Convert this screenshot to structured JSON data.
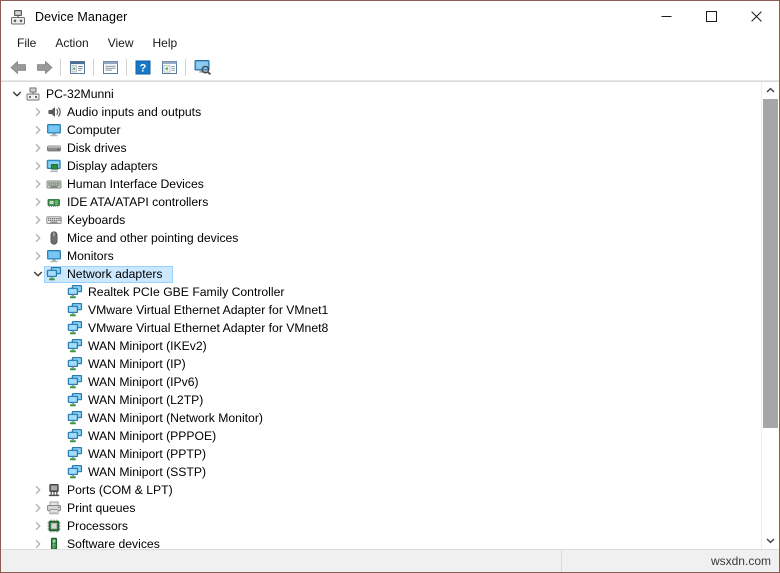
{
  "window": {
    "title": "Device Manager",
    "icon": "device-manager-icon",
    "border_color": "#8d5d53",
    "controls": [
      {
        "name": "minimize",
        "glyph": "minimize-icon"
      },
      {
        "name": "maximize",
        "glyph": "maximize-icon"
      },
      {
        "name": "close",
        "glyph": "close-icon"
      }
    ]
  },
  "menubar": {
    "items": [
      {
        "label": "File"
      },
      {
        "label": "Action"
      },
      {
        "label": "View"
      },
      {
        "label": "Help"
      }
    ]
  },
  "toolbar": {
    "buttons": [
      {
        "name": "back-button",
        "icon": "back-arrow-icon"
      },
      {
        "name": "forward-button",
        "icon": "forward-arrow-icon"
      },
      {
        "name": "separator-1",
        "icon": "separator"
      },
      {
        "name": "show-hide-console-tree-button",
        "icon": "console-tree-icon"
      },
      {
        "name": "separator-2",
        "icon": "separator"
      },
      {
        "name": "properties-button",
        "icon": "properties-icon"
      },
      {
        "name": "separator-3",
        "icon": "separator"
      },
      {
        "name": "help-button",
        "icon": "help-question-icon"
      },
      {
        "name": "update-driver-button",
        "icon": "update-driver-icon"
      },
      {
        "name": "separator-4",
        "icon": "separator"
      },
      {
        "name": "scan-for-hardware-changes-button",
        "icon": "scan-hardware-icon"
      }
    ]
  },
  "tree": {
    "root": {
      "label": "PC-32Munni",
      "icon": "computer-root-icon",
      "expanded": true,
      "indent": 0
    },
    "nodes": [
      {
        "label": "Audio inputs and outputs",
        "icon": "speaker-icon",
        "state": "collapsed",
        "indent": 1
      },
      {
        "label": "Computer",
        "icon": "monitor-icon",
        "state": "collapsed",
        "indent": 1
      },
      {
        "label": "Disk drives",
        "icon": "disk-drive-icon",
        "state": "collapsed",
        "indent": 1
      },
      {
        "label": "Display adapters",
        "icon": "display-adapter-icon",
        "state": "collapsed",
        "indent": 1
      },
      {
        "label": "Human Interface Devices",
        "icon": "hid-icon",
        "state": "collapsed",
        "indent": 1
      },
      {
        "label": "IDE ATA/ATAPI controllers",
        "icon": "ide-controller-icon",
        "state": "collapsed",
        "indent": 1
      },
      {
        "label": "Keyboards",
        "icon": "keyboard-icon",
        "state": "collapsed",
        "indent": 1
      },
      {
        "label": "Mice and other pointing devices",
        "icon": "mouse-icon",
        "state": "collapsed",
        "indent": 1
      },
      {
        "label": "Monitors",
        "icon": "monitor-icon",
        "state": "collapsed",
        "indent": 1
      },
      {
        "label": "Network adapters",
        "icon": "network-adapter-icon",
        "state": "expanded",
        "indent": 1,
        "selected": true
      },
      {
        "label": "Realtek PCIe GBE Family Controller",
        "icon": "network-adapter-icon",
        "state": "leaf",
        "indent": 2
      },
      {
        "label": "VMware Virtual Ethernet Adapter for VMnet1",
        "icon": "network-adapter-icon",
        "state": "leaf",
        "indent": 2
      },
      {
        "label": "VMware Virtual Ethernet Adapter for VMnet8",
        "icon": "network-adapter-icon",
        "state": "leaf",
        "indent": 2
      },
      {
        "label": "WAN Miniport (IKEv2)",
        "icon": "network-adapter-icon",
        "state": "leaf",
        "indent": 2
      },
      {
        "label": "WAN Miniport (IP)",
        "icon": "network-adapter-icon",
        "state": "leaf",
        "indent": 2
      },
      {
        "label": "WAN Miniport (IPv6)",
        "icon": "network-adapter-icon",
        "state": "leaf",
        "indent": 2
      },
      {
        "label": "WAN Miniport (L2TP)",
        "icon": "network-adapter-icon",
        "state": "leaf",
        "indent": 2
      },
      {
        "label": "WAN Miniport (Network Monitor)",
        "icon": "network-adapter-icon",
        "state": "leaf",
        "indent": 2
      },
      {
        "label": "WAN Miniport (PPPOE)",
        "icon": "network-adapter-icon",
        "state": "leaf",
        "indent": 2
      },
      {
        "label": "WAN Miniport (PPTP)",
        "icon": "network-adapter-icon",
        "state": "leaf",
        "indent": 2
      },
      {
        "label": "WAN Miniport (SSTP)",
        "icon": "network-adapter-icon",
        "state": "leaf",
        "indent": 2
      },
      {
        "label": "Ports (COM & LPT)",
        "icon": "port-icon",
        "state": "collapsed",
        "indent": 1
      },
      {
        "label": "Print queues",
        "icon": "printer-icon",
        "state": "collapsed",
        "indent": 1
      },
      {
        "label": "Processors",
        "icon": "processor-icon",
        "state": "collapsed",
        "indent": 1
      },
      {
        "label": "Software devices",
        "icon": "software-device-icon",
        "state": "collapsed",
        "indent": 1
      }
    ]
  },
  "scrollbar": {
    "up_arrow": "chevron-up-icon",
    "down_arrow": "chevron-down-icon",
    "thumb_top_pct": 0,
    "thumb_height_pct": 76
  },
  "statusbar": {
    "text": "",
    "watermark": "wsxdn.com"
  },
  "colors": {
    "selection_fill": "#cce8ff",
    "selection_border": "#99d1ff",
    "window_border": "#8d5d53",
    "statusbar_bg": "#f0f0f0",
    "scroll_thumb": "#a6a6a6"
  }
}
